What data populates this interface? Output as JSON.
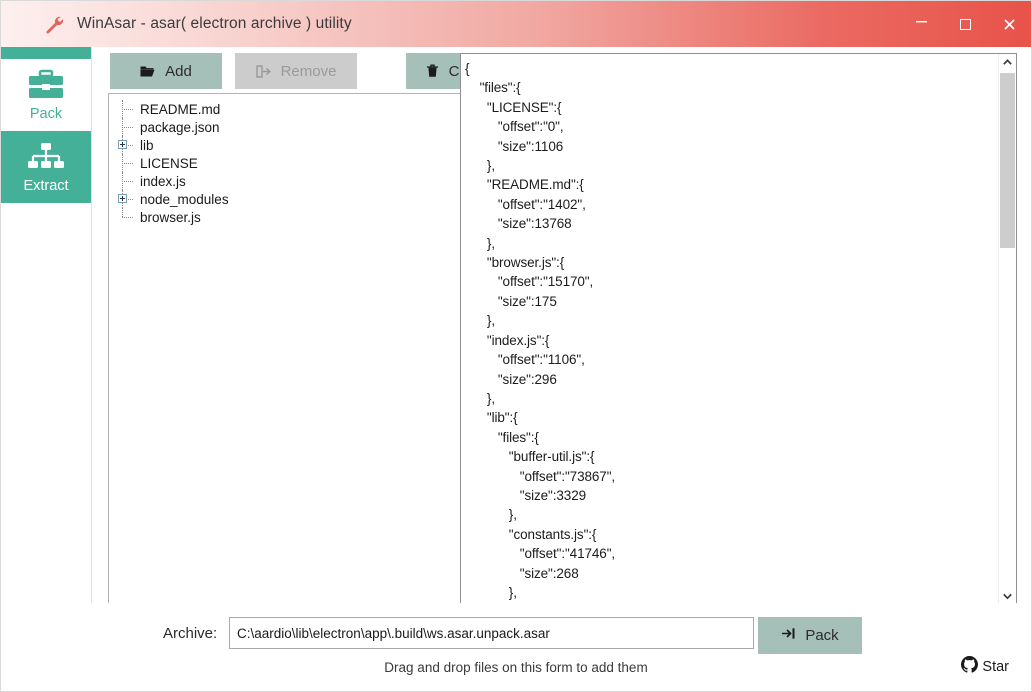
{
  "window": {
    "title": "WinAsar - asar( electron archive ) utility",
    "icon": "wrench-icon",
    "controls": {
      "minimize": "–",
      "maximize": "□",
      "close": "✕"
    }
  },
  "sidebar": {
    "items": [
      {
        "label": "Pack",
        "icon": "briefcase-icon",
        "state": "active"
      },
      {
        "label": "Extract",
        "icon": "sitemap-icon",
        "state": "selected"
      }
    ]
  },
  "toolbar": {
    "add_label": "Add",
    "add_icon": "folder-open-icon",
    "remove_label": "Remove",
    "remove_icon": "exit-arrow-icon",
    "remove_disabled": true,
    "clear_label": "Clear",
    "clear_icon": "trash-icon"
  },
  "tree": {
    "items": [
      {
        "label": "README.md",
        "expandable": false
      },
      {
        "label": "package.json",
        "expandable": false
      },
      {
        "label": "lib",
        "expandable": true
      },
      {
        "label": "LICENSE",
        "expandable": false
      },
      {
        "label": "index.js",
        "expandable": false
      },
      {
        "label": "node_modules",
        "expandable": true
      },
      {
        "label": "browser.js",
        "expandable": false
      }
    ]
  },
  "json_view": {
    "content": "{\n    \"files\":{\n      \"LICENSE\":{\n         \"offset\":\"0\",\n         \"size\":1106\n      },\n      \"README.md\":{\n         \"offset\":\"1402\",\n         \"size\":13768\n      },\n      \"browser.js\":{\n         \"offset\":\"15170\",\n         \"size\":175\n      },\n      \"index.js\":{\n         \"offset\":\"1106\",\n         \"size\":296\n      },\n      \"lib\":{\n         \"files\":{\n            \"buffer-util.js\":{\n               \"offset\":\"73867\",\n               \"size\":3329\n            },\n            \"constants.js\":{\n               \"offset\":\"41746\",\n               \"size\":268\n            },\n            \"event-target.js\":{"
  },
  "footer": {
    "archive_label": "Archive:",
    "archive_value": "C:\\aardio\\lib\\electron\\app\\.build\\ws.asar.unpack.asar",
    "archive_placeholder": "",
    "pack_label": "Pack",
    "pack_icon": "pack-arrow-icon",
    "hint": "Drag and drop files on this form to add them",
    "star_label": "Star",
    "star_icon": "github-icon"
  },
  "colors": {
    "teal": "#45b098",
    "button": "#a5bfb9",
    "disabled": "#cccccc",
    "title_gradient_start": "#fdf0ef",
    "title_gradient_end": "#e8534a"
  }
}
